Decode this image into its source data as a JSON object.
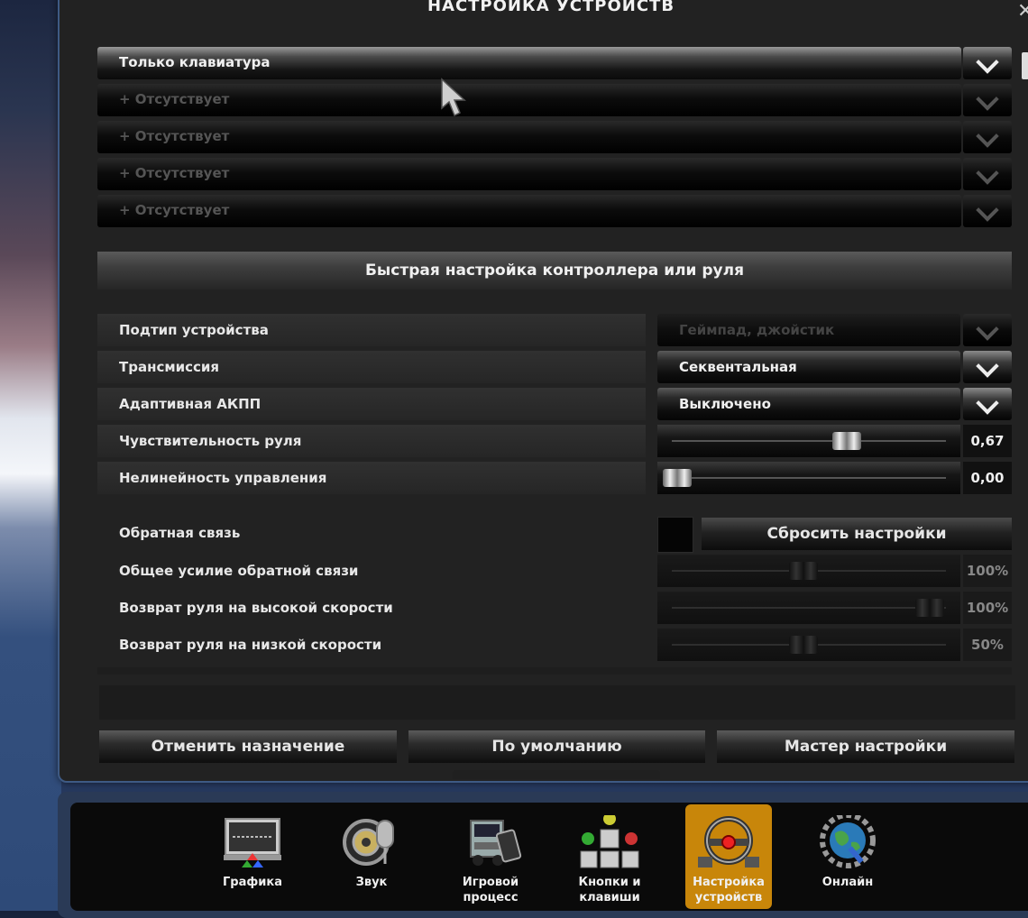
{
  "title": "НАСТРОЙКА УСТРОЙСТВ",
  "close_glyph": "✕",
  "devices": [
    {
      "label": "Только клавиатура",
      "active": true
    },
    {
      "label": "+ Отсутствует",
      "active": false
    },
    {
      "label": "+ Отсутствует",
      "active": false
    },
    {
      "label": "+ Отсутствует",
      "active": false
    },
    {
      "label": "+ Отсутствует",
      "active": false
    }
  ],
  "quick_setup": "Быстрая настройка контроллера или руля",
  "settings": {
    "device_subtype": {
      "label": "Подтип устройства",
      "value": "Геймпад, джойстик"
    },
    "transmission": {
      "label": "Трансмиссия",
      "value": "Секвентальная"
    },
    "adaptive_auto": {
      "label": "Адаптивная АКПП",
      "value": "Выключено"
    },
    "steering_sensitivity": {
      "label": "Чувствительность руля",
      "value": "0,67",
      "level": 0.67
    },
    "steering_nonlinearity": {
      "label": "Нелинейность управления",
      "value": "0,00",
      "level": 0.0
    }
  },
  "feedback": {
    "label": "Обратная связь",
    "reset_label": "Сбросить настройки",
    "overall": {
      "label": "Общее усилие обратной связи",
      "value": "100%",
      "level": 0.5
    },
    "high_speed": {
      "label": "Возврат руля на высокой скорости",
      "value": "100%",
      "level": 1.0
    },
    "low_speed": {
      "label": "Возврат руля на низкой скорости",
      "value": "50%",
      "level": 0.5
    }
  },
  "buttons": {
    "unassign": "Отменить назначение",
    "defaults": "По умолчанию",
    "wizard": "Мастер настройки"
  },
  "menu": [
    {
      "key": "graphics",
      "label": "Графика",
      "icon": "monitor-icon",
      "active": false
    },
    {
      "key": "sound",
      "label": "Звук",
      "icon": "speaker-microphone-icon",
      "active": false
    },
    {
      "key": "gameplay",
      "label": "Игровой процесс",
      "icon": "truck-icon",
      "active": false
    },
    {
      "key": "keys",
      "label": "Кнопки и клавиши",
      "icon": "keys-icon",
      "active": false
    },
    {
      "key": "devices",
      "label": "Настройка устройств",
      "icon": "steering-wheel-icon",
      "active": true
    },
    {
      "key": "online",
      "label": "Онлайн",
      "icon": "globe-gear-icon",
      "active": false
    }
  ],
  "colors": {
    "accent": "#c8860a",
    "frame": "#3e5a84"
  }
}
